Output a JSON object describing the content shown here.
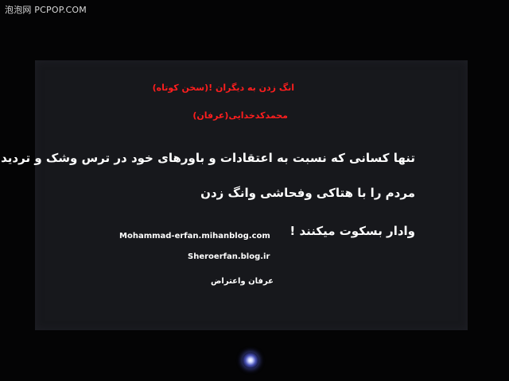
{
  "watermark": "泡泡网 PCPOP.COM",
  "screen": {
    "red_lines": [
      "انگ زدن به دیگران !(سخن کوتاه)",
      "محمدکدخدایی(عرفان)"
    ],
    "main_lines": [
      "تنها کسانی که نسبت به اعتقادات و باورهای خود در ترس وشک و تردیدند ،",
      "مردم را با هتاکی وفحاشی وانگ زدن",
      "وادار بسکوت میکنند !"
    ],
    "blog_url_1": "Mohammad-erfan.mihanblog.com",
    "blog_url_2": "Sheroerfan.blog.ir",
    "signature": "عرفان واعتراض"
  },
  "colors": {
    "heading_red": "#ff1e1e",
    "body_text": "#ffffff",
    "screen_bg": "#17181c",
    "bezel": "#040405",
    "power_led": "#4a53b8"
  },
  "icons": {
    "power_indicator": "power-led-icon"
  }
}
